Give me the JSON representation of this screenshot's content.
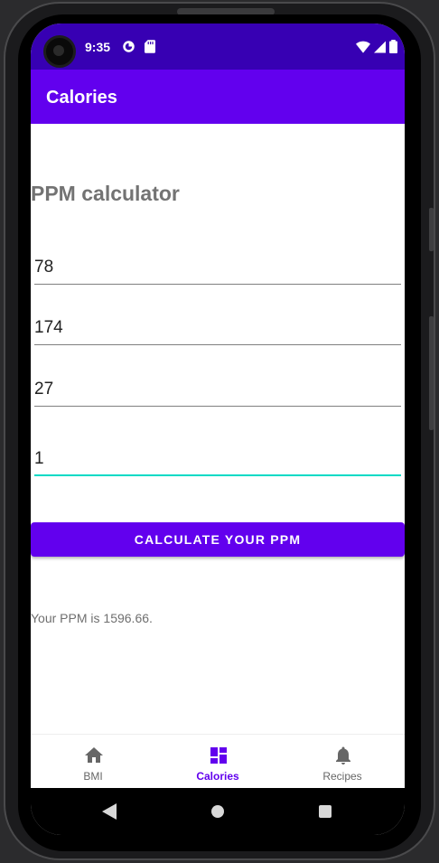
{
  "status_bar": {
    "time": "9:35"
  },
  "app_bar": {
    "title": "Calories"
  },
  "main": {
    "heading": "PPM calculator",
    "fields": [
      {
        "value": "78"
      },
      {
        "value": "174"
      },
      {
        "value": "27"
      },
      {
        "value": "1"
      }
    ],
    "calculate_button": "CALCULATE YOUR PPM",
    "result": "Your PPM is 1596.66."
  },
  "bottom_nav": {
    "items": [
      {
        "label": "BMI",
        "icon": "home-icon",
        "active": false
      },
      {
        "label": "Calories",
        "icon": "dashboard-icon",
        "active": true
      },
      {
        "label": "Recipes",
        "icon": "bell-icon",
        "active": false
      }
    ]
  },
  "colors": {
    "primary": "#6200ee",
    "primary_dark": "#3700b3",
    "accent": "#03dac5"
  }
}
